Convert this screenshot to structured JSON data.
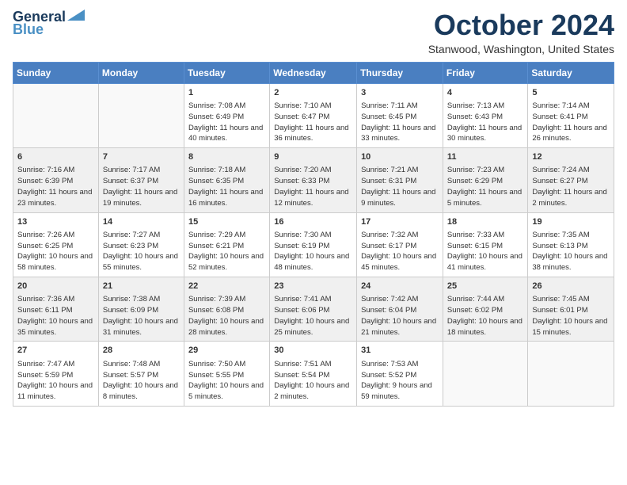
{
  "header": {
    "logo_line1": "General",
    "logo_line2": "Blue",
    "month_title": "October 2024",
    "location": "Stanwood, Washington, United States"
  },
  "days_of_week": [
    "Sunday",
    "Monday",
    "Tuesday",
    "Wednesday",
    "Thursday",
    "Friday",
    "Saturday"
  ],
  "rows": [
    [
      {
        "day": "",
        "content": ""
      },
      {
        "day": "",
        "content": ""
      },
      {
        "day": "1",
        "content": "Sunrise: 7:08 AM\nSunset: 6:49 PM\nDaylight: 11 hours and 40 minutes."
      },
      {
        "day": "2",
        "content": "Sunrise: 7:10 AM\nSunset: 6:47 PM\nDaylight: 11 hours and 36 minutes."
      },
      {
        "day": "3",
        "content": "Sunrise: 7:11 AM\nSunset: 6:45 PM\nDaylight: 11 hours and 33 minutes."
      },
      {
        "day": "4",
        "content": "Sunrise: 7:13 AM\nSunset: 6:43 PM\nDaylight: 11 hours and 30 minutes."
      },
      {
        "day": "5",
        "content": "Sunrise: 7:14 AM\nSunset: 6:41 PM\nDaylight: 11 hours and 26 minutes."
      }
    ],
    [
      {
        "day": "6",
        "content": "Sunrise: 7:16 AM\nSunset: 6:39 PM\nDaylight: 11 hours and 23 minutes."
      },
      {
        "day": "7",
        "content": "Sunrise: 7:17 AM\nSunset: 6:37 PM\nDaylight: 11 hours and 19 minutes."
      },
      {
        "day": "8",
        "content": "Sunrise: 7:18 AM\nSunset: 6:35 PM\nDaylight: 11 hours and 16 minutes."
      },
      {
        "day": "9",
        "content": "Sunrise: 7:20 AM\nSunset: 6:33 PM\nDaylight: 11 hours and 12 minutes."
      },
      {
        "day": "10",
        "content": "Sunrise: 7:21 AM\nSunset: 6:31 PM\nDaylight: 11 hours and 9 minutes."
      },
      {
        "day": "11",
        "content": "Sunrise: 7:23 AM\nSunset: 6:29 PM\nDaylight: 11 hours and 5 minutes."
      },
      {
        "day": "12",
        "content": "Sunrise: 7:24 AM\nSunset: 6:27 PM\nDaylight: 11 hours and 2 minutes."
      }
    ],
    [
      {
        "day": "13",
        "content": "Sunrise: 7:26 AM\nSunset: 6:25 PM\nDaylight: 10 hours and 58 minutes."
      },
      {
        "day": "14",
        "content": "Sunrise: 7:27 AM\nSunset: 6:23 PM\nDaylight: 10 hours and 55 minutes."
      },
      {
        "day": "15",
        "content": "Sunrise: 7:29 AM\nSunset: 6:21 PM\nDaylight: 10 hours and 52 minutes."
      },
      {
        "day": "16",
        "content": "Sunrise: 7:30 AM\nSunset: 6:19 PM\nDaylight: 10 hours and 48 minutes."
      },
      {
        "day": "17",
        "content": "Sunrise: 7:32 AM\nSunset: 6:17 PM\nDaylight: 10 hours and 45 minutes."
      },
      {
        "day": "18",
        "content": "Sunrise: 7:33 AM\nSunset: 6:15 PM\nDaylight: 10 hours and 41 minutes."
      },
      {
        "day": "19",
        "content": "Sunrise: 7:35 AM\nSunset: 6:13 PM\nDaylight: 10 hours and 38 minutes."
      }
    ],
    [
      {
        "day": "20",
        "content": "Sunrise: 7:36 AM\nSunset: 6:11 PM\nDaylight: 10 hours and 35 minutes."
      },
      {
        "day": "21",
        "content": "Sunrise: 7:38 AM\nSunset: 6:09 PM\nDaylight: 10 hours and 31 minutes."
      },
      {
        "day": "22",
        "content": "Sunrise: 7:39 AM\nSunset: 6:08 PM\nDaylight: 10 hours and 28 minutes."
      },
      {
        "day": "23",
        "content": "Sunrise: 7:41 AM\nSunset: 6:06 PM\nDaylight: 10 hours and 25 minutes."
      },
      {
        "day": "24",
        "content": "Sunrise: 7:42 AM\nSunset: 6:04 PM\nDaylight: 10 hours and 21 minutes."
      },
      {
        "day": "25",
        "content": "Sunrise: 7:44 AM\nSunset: 6:02 PM\nDaylight: 10 hours and 18 minutes."
      },
      {
        "day": "26",
        "content": "Sunrise: 7:45 AM\nSunset: 6:01 PM\nDaylight: 10 hours and 15 minutes."
      }
    ],
    [
      {
        "day": "27",
        "content": "Sunrise: 7:47 AM\nSunset: 5:59 PM\nDaylight: 10 hours and 11 minutes."
      },
      {
        "day": "28",
        "content": "Sunrise: 7:48 AM\nSunset: 5:57 PM\nDaylight: 10 hours and 8 minutes."
      },
      {
        "day": "29",
        "content": "Sunrise: 7:50 AM\nSunset: 5:55 PM\nDaylight: 10 hours and 5 minutes."
      },
      {
        "day": "30",
        "content": "Sunrise: 7:51 AM\nSunset: 5:54 PM\nDaylight: 10 hours and 2 minutes."
      },
      {
        "day": "31",
        "content": "Sunrise: 7:53 AM\nSunset: 5:52 PM\nDaylight: 9 hours and 59 minutes."
      },
      {
        "day": "",
        "content": ""
      },
      {
        "day": "",
        "content": ""
      }
    ]
  ]
}
